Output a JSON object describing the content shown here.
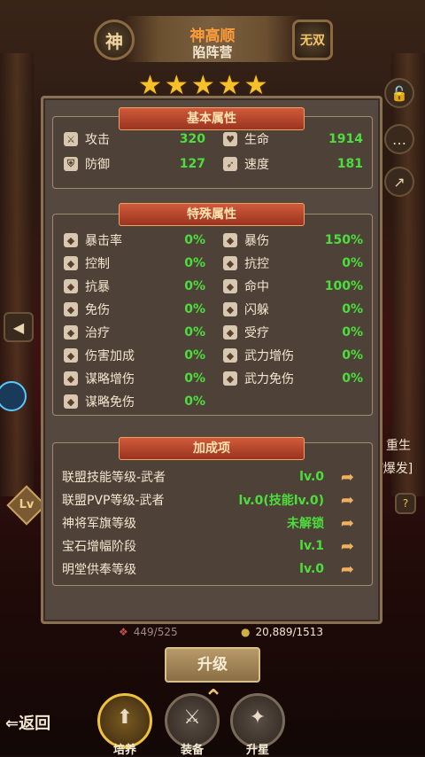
{
  "header": {
    "badge_left": "神",
    "hero_name": "神高顺",
    "hero_class": "陷阵营",
    "badge_right": "无双",
    "stars": 5
  },
  "side": {
    "lock_icon": "lock-icon",
    "chat_icon": "chat-icon",
    "share_icon": "share-icon",
    "left_arrow": "left-arrow-icon",
    "right_text_1": "重生",
    "right_text_2": "/爆发]",
    "level_badge": "Lv"
  },
  "basic": {
    "title": "基本属性",
    "stats": [
      {
        "label": "攻击",
        "value": "320",
        "icon": "sword-icon"
      },
      {
        "label": "生命",
        "value": "1914",
        "icon": "heart-icon"
      },
      {
        "label": "防御",
        "value": "127",
        "icon": "shield-icon"
      },
      {
        "label": "速度",
        "value": "181",
        "icon": "boot-icon"
      }
    ]
  },
  "special": {
    "title": "特殊属性",
    "stats": [
      {
        "label": "暴击率",
        "value": "0%"
      },
      {
        "label": "暴伤",
        "value": "150%"
      },
      {
        "label": "控制",
        "value": "0%"
      },
      {
        "label": "抗控",
        "value": "0%"
      },
      {
        "label": "抗暴",
        "value": "0%"
      },
      {
        "label": "命中",
        "value": "100%"
      },
      {
        "label": "免伤",
        "value": "0%"
      },
      {
        "label": "闪躲",
        "value": "0%"
      },
      {
        "label": "治疗",
        "value": "0%"
      },
      {
        "label": "受疗",
        "value": "0%"
      },
      {
        "label": "伤害加成",
        "value": "0%"
      },
      {
        "label": "武力增伤",
        "value": "0%"
      },
      {
        "label": "谋略增伤",
        "value": "0%"
      },
      {
        "label": "武力免伤",
        "value": "0%"
      },
      {
        "label": "谋略免伤",
        "value": "0%"
      }
    ]
  },
  "bonus": {
    "title": "加成项",
    "items": [
      {
        "label": "联盟技能等级-武者",
        "value": "lv.0"
      },
      {
        "label": "联盟PVP等级-武者",
        "value": "lv.0(技能lv.0)"
      },
      {
        "label": "神将军旗等级",
        "value": "未解锁"
      },
      {
        "label": "宝石增幅阶段",
        "value": "lv.1"
      },
      {
        "label": "明堂供奉等级",
        "value": "lv.0"
      }
    ]
  },
  "counters": {
    "left": "449/525",
    "right": "20,889/1513"
  },
  "upgrade_label": "升级",
  "nav": {
    "back": "返回",
    "tabs": [
      {
        "label": "培养"
      },
      {
        "label": "装备"
      },
      {
        "label": "升星"
      }
    ]
  }
}
